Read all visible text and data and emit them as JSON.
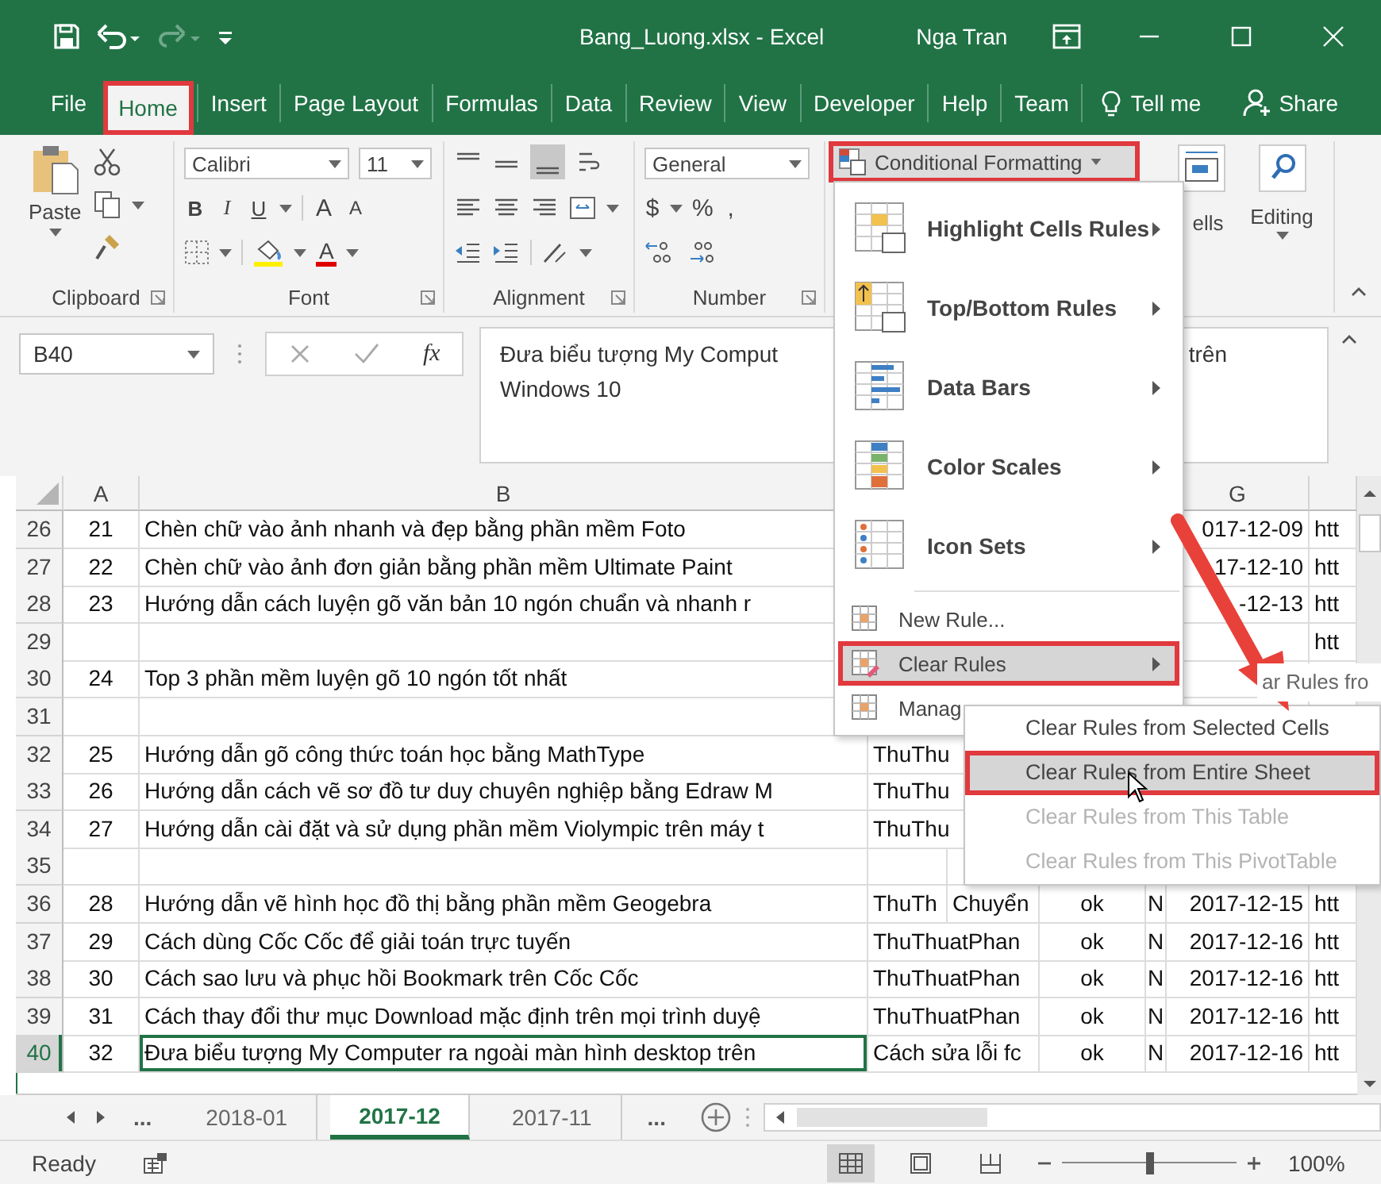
{
  "window": {
    "title": "Bang_Luong.xlsx - Excel",
    "user": "Nga Tran"
  },
  "tabs": [
    {
      "label": "File",
      "selected": false,
      "callout": false
    },
    {
      "label": "Home",
      "selected": true,
      "callout": true
    },
    {
      "label": "Insert",
      "selected": false,
      "callout": false
    },
    {
      "label": "Page Layout",
      "selected": false,
      "callout": false
    },
    {
      "label": "Formulas",
      "selected": false,
      "callout": false
    },
    {
      "label": "Data",
      "selected": false,
      "callout": false
    },
    {
      "label": "Review",
      "selected": false,
      "callout": false
    },
    {
      "label": "View",
      "selected": false,
      "callout": false
    },
    {
      "label": "Developer",
      "selected": false,
      "callout": false
    },
    {
      "label": "Help",
      "selected": false,
      "callout": false
    },
    {
      "label": "Team",
      "selected": false,
      "callout": false
    }
  ],
  "tell_me": "Tell me",
  "share": "Share",
  "ribbon": {
    "paste": "Paste",
    "clipboard_label": "Clipboard",
    "font_name": "Calibri",
    "font_size": "11",
    "style_buttons": [
      "B",
      "I",
      "U"
    ],
    "size_buttons": [
      "A",
      "A"
    ],
    "font_color": "A",
    "font_label": "Font",
    "alignment_label": "Alignment",
    "number_format": "General",
    "number_buttons": [
      "$",
      "%",
      ","
    ],
    "number_label": "Number",
    "conditional_formatting": {
      "label": "Conditional Formatting",
      "callout": true
    },
    "cells_label": "ells",
    "editing_label": "Editing"
  },
  "formula_bar": {
    "name_box": "B40",
    "fx": "fx",
    "text_parts": [
      "Đưa biểu tượng My Comput",
      "trên",
      "Windows 10"
    ]
  },
  "grid": {
    "column_headers": {
      "a": "A",
      "b": "B",
      "g": "G"
    },
    "rows": [
      {
        "num": "26",
        "a": "21",
        "b": "Chèn chữ vào ảnh nhanh và đẹp bằng phần mềm Foto",
        "g": "017-12-09",
        "h": "htt",
        "selected": false
      },
      {
        "num": "27",
        "a": "22",
        "b": "Chèn chữ vào ảnh đơn giản bằng phần mềm Ultimate Paint",
        "g": "17-12-10",
        "h": "htt",
        "selected": false
      },
      {
        "num": "28",
        "a": "23",
        "b": "Hướng dẫn cách luyện gõ văn bản 10 ngón chuẩn và nhanh r",
        "g": "-12-13",
        "h": "htt",
        "selected": false
      },
      {
        "num": "29",
        "h": "htt",
        "selected": false
      },
      {
        "num": "30",
        "a": "24",
        "b": "Top 3 phần mềm luyện gõ 10 ngón tốt nhất",
        "selected": false
      },
      {
        "num": "31",
        "selected": false
      },
      {
        "num": "32",
        "a": "25",
        "b": "Hướng dẫn gõ công thức toán học bằng MathType",
        "c": "ThuThu",
        "selected": false
      },
      {
        "num": "33",
        "a": "26",
        "b": "Hướng dẫn cách vẽ sơ đồ tư duy chuyên nghiệp bằng Edraw M",
        "c": "ThuThu",
        "selected": false
      },
      {
        "num": "34",
        "a": "27",
        "b": "Hướng dẫn cài đặt và sử dụng phần mềm Violympic trên máy t",
        "c": "ThuThu",
        "selected": false
      },
      {
        "num": "35",
        "selected": false
      },
      {
        "num": "36",
        "a": "28",
        "b": "Hướng dẫn vẽ hình học đồ thị bằng phần mềm Geogebra",
        "c": "ThuTh",
        "d": "Chuyển",
        "e": "ok",
        "f": "N",
        "g": "2017-12-15",
        "h": "htt",
        "selected": false
      },
      {
        "num": "37",
        "a": "29",
        "b": "Cách dùng Cốc Cốc để giải toán trực tuyến",
        "c": "ThuThuatPhan",
        "e": "ok",
        "f": "N",
        "g": "2017-12-16",
        "h": "htt",
        "selected": false
      },
      {
        "num": "38",
        "a": "30",
        "b": "Cách sao lưu và phục hồi Bookmark trên Cốc Cốc",
        "c": "ThuThuatPhan",
        "e": "ok",
        "f": "N",
        "g": "2017-12-16",
        "h": "htt",
        "selected": false
      },
      {
        "num": "39",
        "a": "31",
        "b": "Cách thay đổi thư mục Download mặc định trên mọi trình duyệ",
        "c": "ThuThuatPhan",
        "e": "ok",
        "f": "N",
        "g": "2017-12-16",
        "h": "htt",
        "selected": false
      },
      {
        "num": "40",
        "a": "32",
        "b": "Đưa biểu tượng My Computer ra ngoài màn hình desktop trên",
        "c": "Cách sửa lỗi fc",
        "e": "ok",
        "f": "N",
        "g": "2017-12-16",
        "h": "htt",
        "selected": true
      }
    ]
  },
  "menu": {
    "items": [
      {
        "kind": "large",
        "label": "Highlight Cells Rules",
        "submenu": true,
        "highlighted": false,
        "callout": false
      },
      {
        "kind": "large",
        "label": "Top/Bottom Rules",
        "submenu": true,
        "highlighted": false,
        "callout": false
      },
      {
        "kind": "large",
        "label": "Data Bars",
        "submenu": true,
        "highlighted": false,
        "callout": false
      },
      {
        "kind": "large",
        "label": "Color Scales",
        "submenu": true,
        "highlighted": false,
        "callout": false
      },
      {
        "kind": "large",
        "label": "Icon Sets",
        "submenu": true,
        "highlighted": false,
        "callout": false
      },
      {
        "kind": "small",
        "label": "New Rule...",
        "submenu": false,
        "highlighted": false,
        "callout": false
      },
      {
        "kind": "small",
        "label": "Clear Rules",
        "submenu": true,
        "highlighted": true,
        "callout": true
      },
      {
        "kind": "small",
        "label": "Manag",
        "submenu": false,
        "highlighted": false,
        "callout": false
      }
    ]
  },
  "submenu": {
    "partial_item": "ar Rules fro",
    "items": [
      {
        "label": "Clear Rules from Selected Cells",
        "disabled": false,
        "highlighted": false,
        "callout": false
      },
      {
        "label": "Clear Rules from Entire Sheet",
        "disabled": false,
        "highlighted": true,
        "callout": true
      },
      {
        "label": "Clear Rules from This Table",
        "disabled": true,
        "highlighted": false,
        "callout": false
      },
      {
        "label": "Clear Rules from This PivotTable",
        "disabled": true,
        "highlighted": false,
        "callout": false
      }
    ]
  },
  "sheet_tabs": {
    "more_left": "...",
    "sheets": [
      {
        "label": "2018-01",
        "selected": false
      },
      {
        "label": "2017-12",
        "selected": true
      },
      {
        "label": "2017-11",
        "selected": false
      }
    ],
    "more_right": "..."
  },
  "status_bar": {
    "text": "Ready",
    "views": [
      {
        "selected": true
      },
      {
        "selected": false
      },
      {
        "selected": false
      }
    ],
    "zoom": {
      "level": 0.5,
      "label": "100%"
    }
  }
}
